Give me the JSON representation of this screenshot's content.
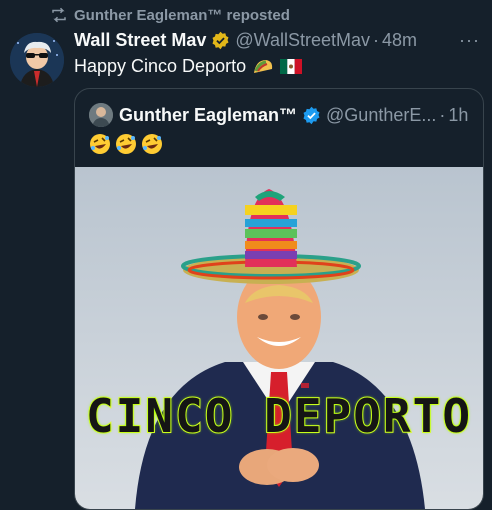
{
  "repost": {
    "label": "Gunther Eagleman™ reposted"
  },
  "tweet": {
    "author_name": "Wall Street Mav",
    "handle": "@WallStreetMav",
    "separator": "·",
    "time": "48m",
    "text": "Happy Cinco Deporto",
    "more_label": "···"
  },
  "quote": {
    "author_name": "Gunther Eagleman™",
    "handle": "@GuntherE...",
    "separator": "·",
    "time": "1h",
    "media_caption": "CINCO DEPORTO"
  },
  "icons": {
    "repost": "repost-icon",
    "verified": "verified-badge-icon",
    "taco": "taco-emoji",
    "flag": "mexico-flag-emoji",
    "laugh": "rolling-on-floor-laughing-emoji"
  },
  "colors": {
    "background": "#15202b",
    "secondary_text": "#8b98a5",
    "verified_gold": "#e2b719",
    "verified_blue": "#1d9bf0",
    "border": "#38444d"
  }
}
